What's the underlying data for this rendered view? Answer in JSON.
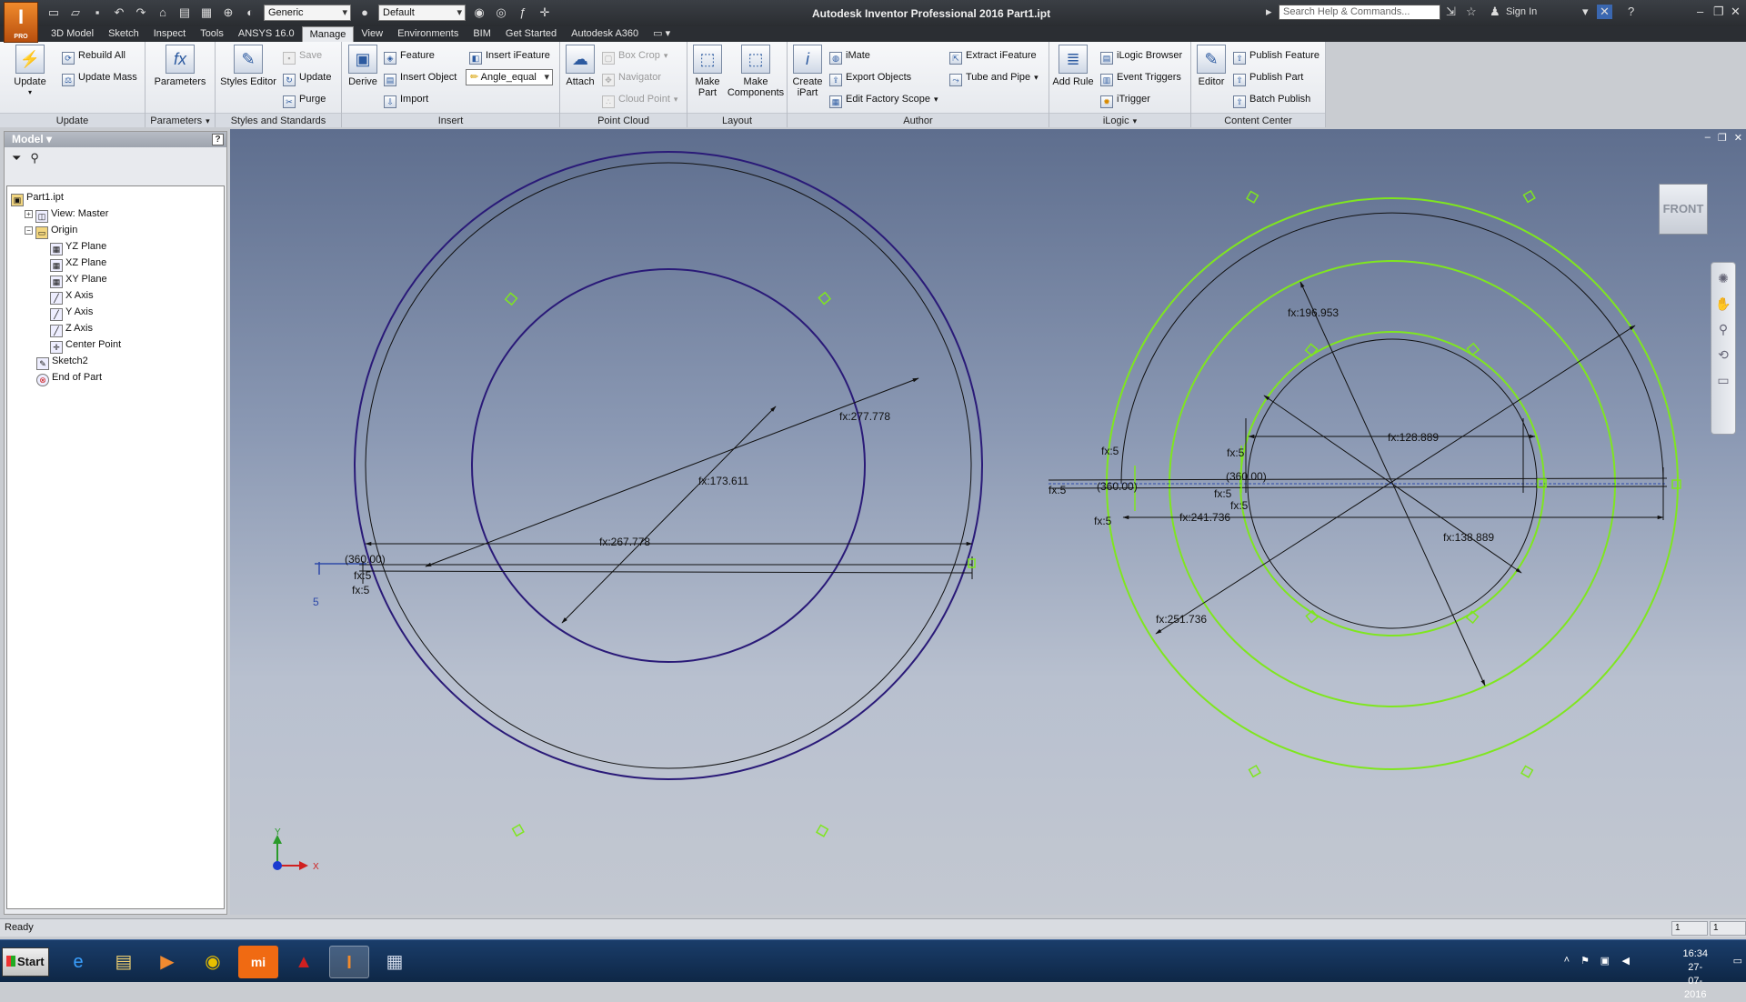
{
  "app": {
    "title": "Autodesk Inventor Professional 2016   Part1.ipt",
    "app_badge": "I",
    "app_badge_sub": "PRO",
    "search_placeholder": "Search Help & Commands...",
    "sign_in": "Sign In",
    "style_combo": "Generic",
    "appearance_combo": "Default"
  },
  "tabs": [
    "3D Model",
    "Sketch",
    "Inspect",
    "Tools",
    "ANSYS 16.0",
    "Manage",
    "View",
    "Environments",
    "BIM",
    "Get Started",
    "Autodesk A360"
  ],
  "active_tab": "Manage",
  "ribbon": {
    "update": {
      "label": "Update",
      "big": "Update",
      "rebuild": "Rebuild All",
      "update_mass": "Update Mass"
    },
    "parameters": {
      "label": "Parameters",
      "big": "Parameters"
    },
    "styles": {
      "label": "Styles and Standards",
      "editor": "Styles Editor",
      "save": "Save",
      "update": "Update",
      "purge": "Purge"
    },
    "insert": {
      "label": "Insert",
      "derive": "Derive",
      "feature": "Feature",
      "insert_object": "Insert Object",
      "import": "Import",
      "insert_ifeature": "Insert iFeature",
      "angle_combo": "Angle_equal"
    },
    "point_cloud": {
      "label": "Point Cloud",
      "attach": "Attach",
      "box_crop": "Box Crop",
      "navigator": "Navigator",
      "cloud_point": "Cloud Point"
    },
    "layout": {
      "label": "Layout",
      "make_part": "Make Part",
      "make_components": "Make Components"
    },
    "author": {
      "label": "Author",
      "create_ipart": "Create iPart",
      "imate": "iMate",
      "export_objects": "Export Objects",
      "edit_factory_scope": "Edit Factory Scope",
      "extract_ifeature": "Extract iFeature",
      "tube_pipe": "Tube and Pipe"
    },
    "ilogic": {
      "label": "iLogic",
      "add_rule": "Add Rule",
      "browser": "iLogic Browser",
      "event_triggers": "Event Triggers",
      "itrigger": "iTrigger"
    },
    "content_center": {
      "label": "Content Center",
      "editor": "Editor",
      "publish_feature": "Publish Feature",
      "publish_part": "Publish Part",
      "batch_publish": "Batch Publish"
    }
  },
  "browser": {
    "title": "Model",
    "help": "?",
    "items": [
      {
        "label": "Part1.ipt",
        "level": 0,
        "icon": "part-icon"
      },
      {
        "label": "View: Master",
        "level": 1,
        "icon": "view-icon",
        "expand": "+"
      },
      {
        "label": "Origin",
        "level": 1,
        "icon": "folder-icon",
        "expand": "−"
      },
      {
        "label": "YZ Plane",
        "level": 2,
        "icon": "plane-icon"
      },
      {
        "label": "XZ Plane",
        "level": 2,
        "icon": "plane-icon"
      },
      {
        "label": "XY Plane",
        "level": 2,
        "icon": "plane-icon"
      },
      {
        "label": "X Axis",
        "level": 2,
        "icon": "axis-icon"
      },
      {
        "label": "Y Axis",
        "level": 2,
        "icon": "axis-icon"
      },
      {
        "label": "Z Axis",
        "level": 2,
        "icon": "axis-icon"
      },
      {
        "label": "Center Point",
        "level": 2,
        "icon": "point-icon"
      },
      {
        "label": "Sketch2",
        "level": 1,
        "icon": "sketch-icon"
      },
      {
        "label": "End of Part",
        "level": 1,
        "icon": "end-of-part-icon"
      }
    ]
  },
  "viewcube": {
    "face": "FRONT"
  },
  "triad": {
    "x": "X",
    "y": "Y"
  },
  "dimensions": {
    "left": {
      "outer": "fx:277.778",
      "inner": "fx:173.611",
      "horizontal": "fx:267.778",
      "angle": "(360.00)",
      "fx5a": "fx:5",
      "fx5b": "fx:5",
      "five": "5"
    },
    "right": {
      "d1": "fx:196.953",
      "d2": "fx:128.889",
      "d3": "fx:138.889",
      "d4": "fx:241.736",
      "d5": "fx:251.736",
      "angle_a": "(360.00)",
      "angle_b": "(360.00)",
      "fx5": "fx:5"
    }
  },
  "status": {
    "text": "Ready",
    "count1": "1",
    "count2": "1"
  },
  "taskbar": {
    "start": "Start",
    "time": "16:34",
    "date": "27-07-2016"
  },
  "colors": {
    "sketch_purple": "#2a1a78",
    "constraint_green": "#7fe61f",
    "accent_orange": "#e0731a"
  }
}
